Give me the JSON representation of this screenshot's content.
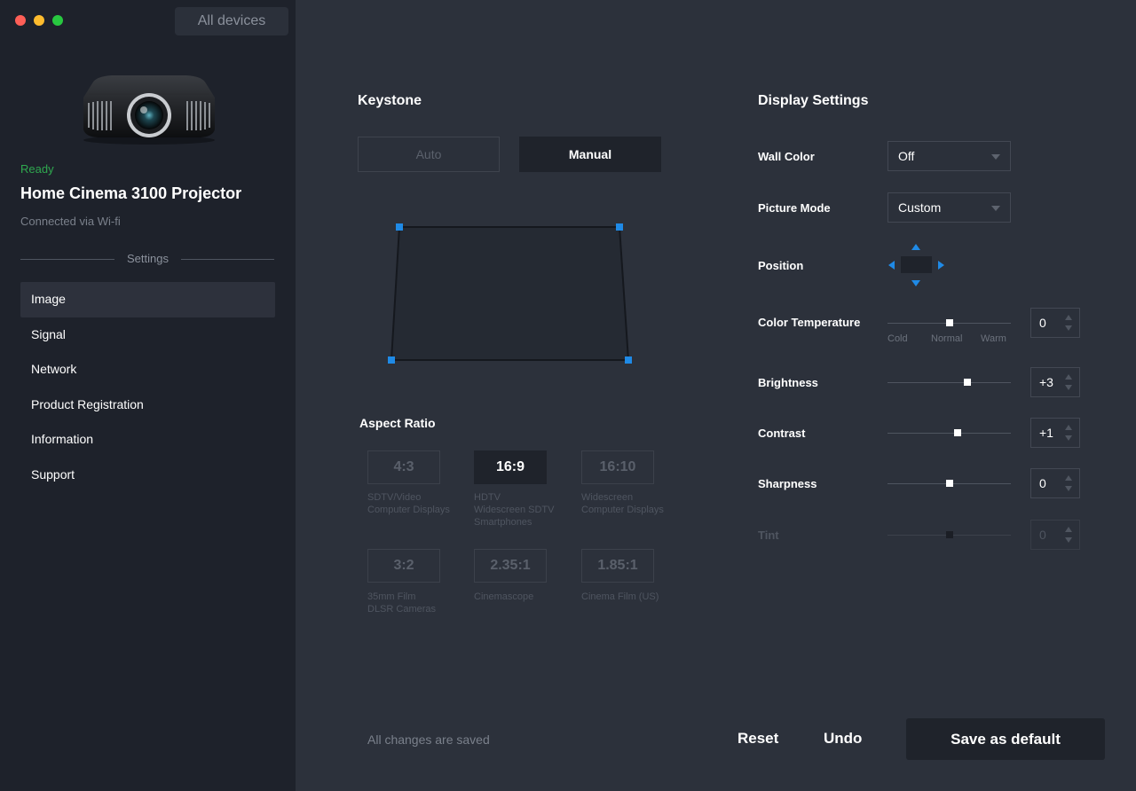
{
  "window": {
    "all_devices_label": "All devices"
  },
  "device": {
    "status": "Ready",
    "name": "Home Cinema 3100 Projector",
    "connection": "Connected via Wi-fi"
  },
  "sidebar": {
    "section_label": "Settings",
    "items": [
      {
        "label": "Image",
        "active": true
      },
      {
        "label": "Signal"
      },
      {
        "label": "Network"
      },
      {
        "label": "Product Registration"
      },
      {
        "label": "Information"
      },
      {
        "label": "Support"
      }
    ]
  },
  "keystone": {
    "title": "Keystone",
    "auto_label": "Auto",
    "manual_label": "Manual",
    "selected": "Manual"
  },
  "aspect_ratio": {
    "title": "Aspect Ratio",
    "selected": "16:9",
    "options": [
      {
        "label": "4:3",
        "desc": "SDTV/Video\nComputer Displays"
      },
      {
        "label": "16:9",
        "desc": "HDTV\nWidescreen SDTV\nSmartphones"
      },
      {
        "label": "16:10",
        "desc": "Widescreen\nComputer Displays"
      },
      {
        "label": "3:2",
        "desc": "35mm Film\nDLSR Cameras"
      },
      {
        "label": "2.35:1",
        "desc": "Cinemascope"
      },
      {
        "label": "1.85:1",
        "desc": "Cinema Film (US)"
      }
    ]
  },
  "display": {
    "title": "Display Settings",
    "wall_color": {
      "label": "Wall Color",
      "value": "Off"
    },
    "picture_mode": {
      "label": "Picture Mode",
      "value": "Custom"
    },
    "position": {
      "label": "Position"
    },
    "color_temperature": {
      "label": "Color Temperature",
      "value": "0",
      "level": 0.5,
      "ticks": [
        "Cold",
        "Normal",
        "Warm"
      ]
    },
    "brightness": {
      "label": "Brightness",
      "value": "+3",
      "level": 0.65
    },
    "contrast": {
      "label": "Contrast",
      "value": "+1",
      "level": 0.57
    },
    "sharpness": {
      "label": "Sharpness",
      "value": "0",
      "level": 0.5
    },
    "tint": {
      "label": "Tint",
      "value": "0",
      "level": 0.5,
      "disabled": true
    }
  },
  "footer": {
    "status": "All changes are saved",
    "reset_label": "Reset",
    "undo_label": "Undo",
    "save_default_label": "Save as default"
  },
  "colors": {
    "accent": "#1f8ae6",
    "ready": "#2fa84f",
    "sidebar_bg": "#1e222b",
    "main_bg": "#2c313b"
  }
}
